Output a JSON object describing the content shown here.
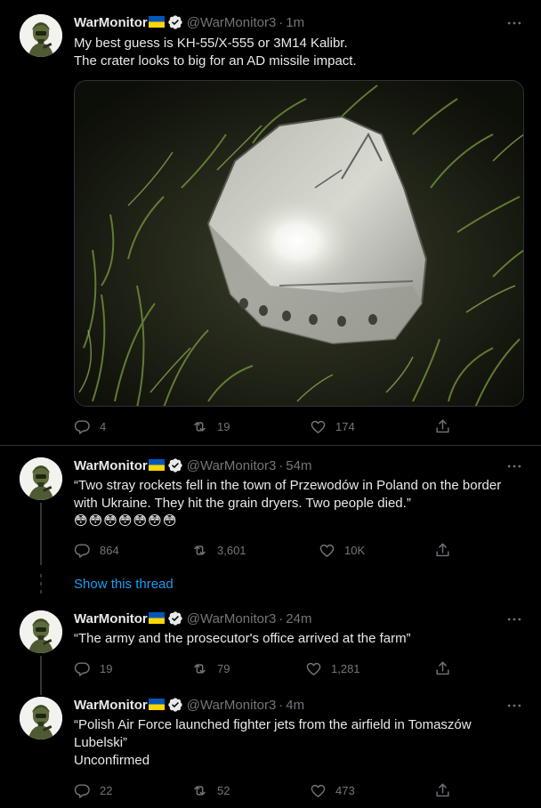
{
  "tweets": [
    {
      "name": "WarMonitor",
      "handle": "@WarMonitor3",
      "time": "1m",
      "lines": [
        "My best guess is KH-55/X-555 or 3M14 Kalibr.",
        "The crater looks to big for an AD missile impact."
      ],
      "replies": "4",
      "retweets": "19",
      "likes": "174"
    },
    {
      "name": "WarMonitor",
      "handle": "@WarMonitor3",
      "time": "54m",
      "lines": [
        "“Two stray rockets fell in the town of Przewodów in Poland on the border",
        "with Ukraine. They hit the grain dryers. Two people died.”"
      ],
      "emoji": "😳😳😳😳😳😳😳",
      "replies": "864",
      "retweets": "3,601",
      "likes": "10K"
    },
    {
      "name": "WarMonitor",
      "handle": "@WarMonitor3",
      "time": "24m",
      "lines": [
        "“The army and the prosecutor's office arrived at the farm”"
      ],
      "replies": "19",
      "retweets": "79",
      "likes": "1,281"
    },
    {
      "name": "WarMonitor",
      "handle": "@WarMonitor3",
      "time": "4m",
      "lines": [
        "“Polish Air Force launched fighter jets from the airfield in Tomaszów",
        "Lubelski”",
        "Unconfirmed"
      ],
      "replies": "22",
      "retweets": "52",
      "likes": "473"
    }
  ],
  "show_thread": "Show this thread",
  "colors": {
    "background": "#000000",
    "text": "#e7e9ea",
    "muted": "#71767b",
    "link": "#1d9bf0",
    "verified": "#e7e9ea",
    "flag_top": "#0057b7",
    "flag_bottom": "#ffd700"
  },
  "icons": [
    "reply-icon",
    "retweet-icon",
    "like-icon",
    "share-icon",
    "more-icon",
    "verified-icon",
    "ukraine-flag-icon"
  ]
}
